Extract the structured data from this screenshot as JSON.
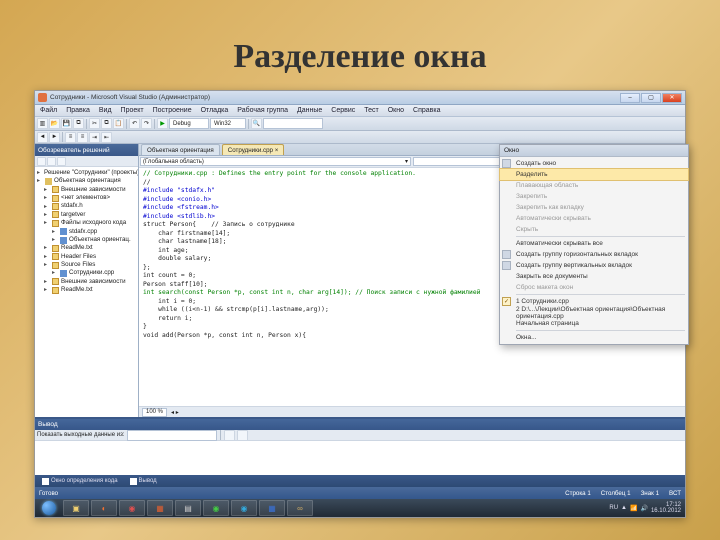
{
  "slide": {
    "title": "Разделение окна"
  },
  "vs": {
    "window_title": "Сотрудники - Microsoft Visual Studio (Администратор)",
    "menu": [
      "Файл",
      "Правка",
      "Вид",
      "Проект",
      "Построение",
      "Отладка",
      "Рабочая группа",
      "Данные",
      "Сервис",
      "Тест",
      "Окно",
      "Справка"
    ],
    "config_combo": "Debug",
    "platform_combo": "Win32",
    "solution_panel_title": "Обозреватель решений",
    "tree": {
      "solution": "Решение \"Сотрудники\" (проекты)",
      "project": "Объектная ориентация",
      "nodes": [
        {
          "lvl": 1,
          "icon": "fold",
          "label": "Внешние зависимости"
        },
        {
          "lvl": 1,
          "icon": "fold",
          "label": "<нет элементов>",
          "note": true
        },
        {
          "lvl": 1,
          "icon": "fold",
          "label": "stdafx.h"
        },
        {
          "lvl": 1,
          "icon": "fold",
          "label": "targetver"
        },
        {
          "lvl": 1,
          "icon": "fold",
          "label": "Файлы исходного кода"
        },
        {
          "lvl": 2,
          "icon": "cpp",
          "label": "stdafx.cpp"
        },
        {
          "lvl": 2,
          "icon": "cpp",
          "label": "Объектная ориентац."
        },
        {
          "lvl": 1,
          "icon": "fold",
          "label": "ReadMe.txt"
        },
        {
          "lvl": 1,
          "icon": "fold",
          "label": "Header Files"
        },
        {
          "lvl": 1,
          "icon": "fold",
          "label": "Source Files"
        },
        {
          "lvl": 2,
          "icon": "cpp",
          "label": "Сотрудники.cpp"
        },
        {
          "lvl": 1,
          "icon": "fold",
          "label": "Внешние зависимости"
        },
        {
          "lvl": 1,
          "icon": "fold",
          "label": "ReadMe.txt"
        }
      ]
    },
    "editor": {
      "tabs": [
        {
          "label": "Объектная ориентация",
          "active": false
        },
        {
          "label": "Сотрудники.cpp ×",
          "active": true
        }
      ],
      "nav_left": "(Глобальная область)",
      "nav_right": "",
      "code": [
        {
          "cls": "c-com",
          "t": "// Сотрудники.cpp : Defines the entry point for the console application."
        },
        {
          "cls": "",
          "t": "//"
        },
        {
          "cls": "",
          "t": ""
        },
        {
          "cls": "c-pp",
          "t": "#include \"stdafx.h\""
        },
        {
          "cls": "c-pp",
          "t": "#include <conio.h>"
        },
        {
          "cls": "c-pp",
          "t": "#include <fstream.h>"
        },
        {
          "cls": "c-pp",
          "t": "#include <stdlib.h>"
        },
        {
          "cls": "",
          "t": ""
        },
        {
          "cls": "",
          "t": "struct Person{    // Запись о сотруднике"
        },
        {
          "cls": "",
          "t": ""
        },
        {
          "cls": "",
          "t": "    char firstname[14];"
        },
        {
          "cls": "",
          "t": "    char lastname[18];"
        },
        {
          "cls": "",
          "t": "    int age;"
        },
        {
          "cls": "",
          "t": "    double salary;"
        },
        {
          "cls": "",
          "t": "};"
        },
        {
          "cls": "",
          "t": ""
        },
        {
          "cls": "",
          "t": "int count = 0;"
        },
        {
          "cls": "",
          "t": ""
        },
        {
          "cls": "",
          "t": "Person staff[10];"
        },
        {
          "cls": "",
          "t": ""
        },
        {
          "cls": "c-com",
          "t": "int search(const Person *p, const int n, char arg[14]); // Поиск записи с нужной фамилией"
        },
        {
          "cls": "",
          "t": ""
        },
        {
          "cls": "",
          "t": "    int i = 0;"
        },
        {
          "cls": "",
          "t": "    while ((i<n-1) && strcmp(p[i].lastname,arg));"
        },
        {
          "cls": "",
          "t": "    return i;"
        },
        {
          "cls": "",
          "t": "}"
        },
        {
          "cls": "",
          "t": ""
        },
        {
          "cls": "",
          "t": "void add(Person *p, const int n, Person x){"
        }
      ],
      "zoom": "100 %"
    },
    "output": {
      "title": "Вывод",
      "show_label": "Показать выходные данные из:",
      "show_value": ""
    },
    "bottom_tabs": [
      "Окно определения кода",
      "Вывод"
    ],
    "status": {
      "left": "Готово",
      "line": "Строка 1",
      "col": "Столбец 1",
      "chr": "Знак 1",
      "ins": "ВСТ"
    }
  },
  "window_menu": {
    "header": "Окно",
    "items": [
      {
        "label": "Создать окно",
        "icon": true
      },
      {
        "label": "Разделить",
        "sel": true
      },
      {
        "label": "Плавающая область",
        "disabled": true
      },
      {
        "label": "Закрепить",
        "disabled": true
      },
      {
        "label": "Закрепить как вкладку",
        "disabled": true
      },
      {
        "label": "Автоматически скрывать",
        "disabled": true
      },
      {
        "label": "Скрыть",
        "disabled": true
      },
      {
        "sep": true
      },
      {
        "label": "Автоматически скрывать все"
      },
      {
        "label": "Создать группу горизонтальных вкладок",
        "icon": true
      },
      {
        "label": "Создать группу вертикальных вкладок",
        "icon": true
      },
      {
        "label": "Закрыть все документы"
      },
      {
        "label": "Сброс макета окон",
        "disabled": true
      },
      {
        "sep": true
      },
      {
        "label": "1 Сотрудники.cpp",
        "check": true
      },
      {
        "label": "2 D:\\...\\Лекции\\Объектная ориентация\\Объектная ориентация.cpp"
      },
      {
        "label": "Начальная страница"
      },
      {
        "sep": true
      },
      {
        "label": "Окна..."
      }
    ]
  },
  "taskbar": {
    "clock_time": "17:12",
    "clock_date": "16.10.2012",
    "lang": "RU"
  }
}
